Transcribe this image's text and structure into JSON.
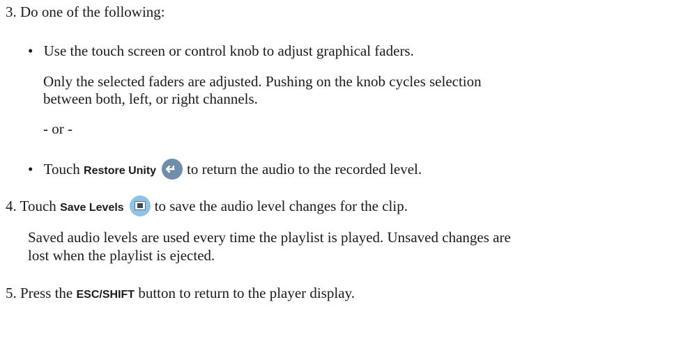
{
  "steps": [
    {
      "number": "3.",
      "text": "Do one of the following:"
    },
    {
      "number": "4.",
      "text_before": "Touch",
      "bold": "Save Levels",
      "text_after": "to save the audio level changes for the clip.",
      "icon": "save-levels-icon"
    },
    {
      "number": "5.",
      "text_before": "Press the",
      "bold": "ESC/SHIFT",
      "text_after": "button to return to the player display."
    }
  ],
  "bullets": [
    {
      "mark": "•",
      "text": "Use the touch screen or control knob to adjust graphical faders.",
      "note_line1": "Only the selected faders are adjusted. Pushing on the knob cycles selection",
      "note_line2": "between both, left, or right channels."
    },
    {
      "mark": "•",
      "text_before": "Touch",
      "bold": "Restore Unity",
      "text_after": "to return the audio to the recorded level.",
      "icon": "restore-unity-icon"
    }
  ],
  "or_separator": "- or -",
  "step4_note_line1": "Saved audio levels are used every time the playlist is played. Unsaved changes are",
  "step4_note_line2": "lost when the playlist is ejected."
}
